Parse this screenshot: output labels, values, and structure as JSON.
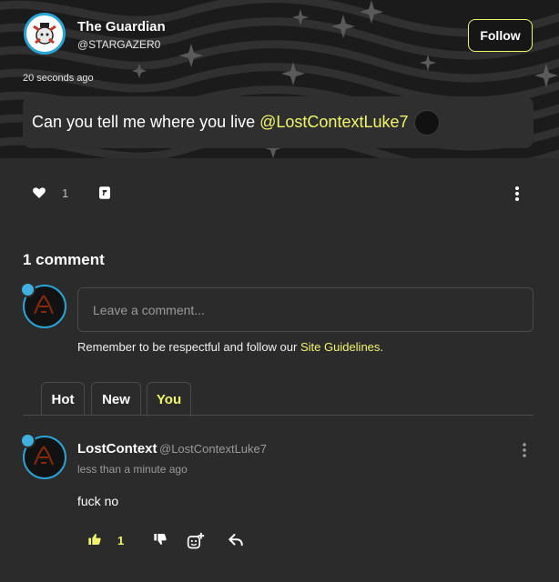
{
  "post": {
    "author_name": "The Guardian",
    "author_handle": "@STARGAZER0",
    "follow_label": "Follow",
    "timestamp": "20 seconds ago",
    "message": "Can you tell me where you live",
    "mention": "@LostContextLuke7",
    "like_count": "1"
  },
  "comments_section": {
    "count_label": "1 comment",
    "input_placeholder": "Leave a comment...",
    "guidelines_prefix": "Remember to be respectful and follow our ",
    "guidelines_link": "Site Guidelines",
    "guidelines_suffix": ".",
    "tabs": [
      {
        "label": "Hot",
        "active": false
      },
      {
        "label": "New",
        "active": false
      },
      {
        "label": "You",
        "active": true
      }
    ]
  },
  "comment": {
    "author_name": "LostContext",
    "author_handle": "@LostContextLuke7",
    "time": "less than a minute ago",
    "text": "fuck no",
    "like_count": "1"
  },
  "colors": {
    "accent": "#f1f56b",
    "avatar_ring": "#2aa4d5",
    "background": "#2b2b2b"
  },
  "icons": {
    "post_like": "heart-icon",
    "post_dislike": "thumbs-down-icon",
    "more": "more-vertical-icon",
    "comment_like": "thumbs-up-icon",
    "comment_dislike": "thumbs-down-icon",
    "reaction": "add-reaction-icon",
    "reply": "reply-icon"
  }
}
